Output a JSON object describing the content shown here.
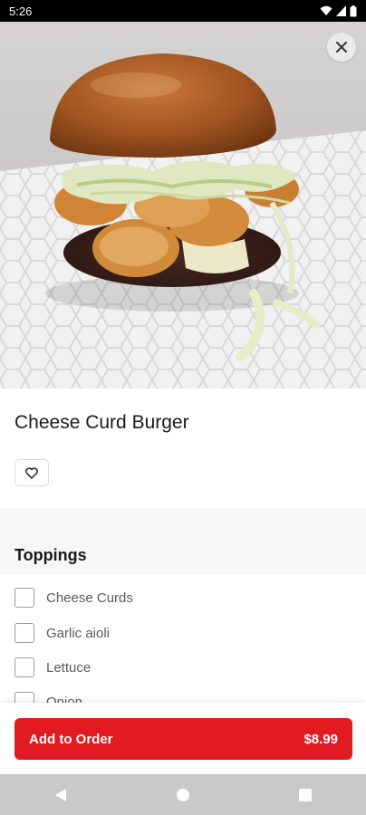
{
  "status_bar": {
    "time": "5:26"
  },
  "product": {
    "title": "Cheese Curd Burger"
  },
  "toppings": {
    "title": "Toppings",
    "items": [
      {
        "label": "Cheese Curds"
      },
      {
        "label": "Garlic aioli"
      },
      {
        "label": "Lettuce"
      },
      {
        "label": "Onion"
      }
    ]
  },
  "order_bar": {
    "button_label": "Add to Order",
    "price": "$8.99"
  },
  "colors": {
    "accent": "#e21b22",
    "nav_bar": "#c9c9c9",
    "section_bg": "#f6f6f6"
  },
  "icons": [
    "wifi-icon",
    "signal-icon",
    "battery-icon",
    "close-icon",
    "heart-icon",
    "back-icon",
    "home-icon",
    "recents-icon"
  ]
}
